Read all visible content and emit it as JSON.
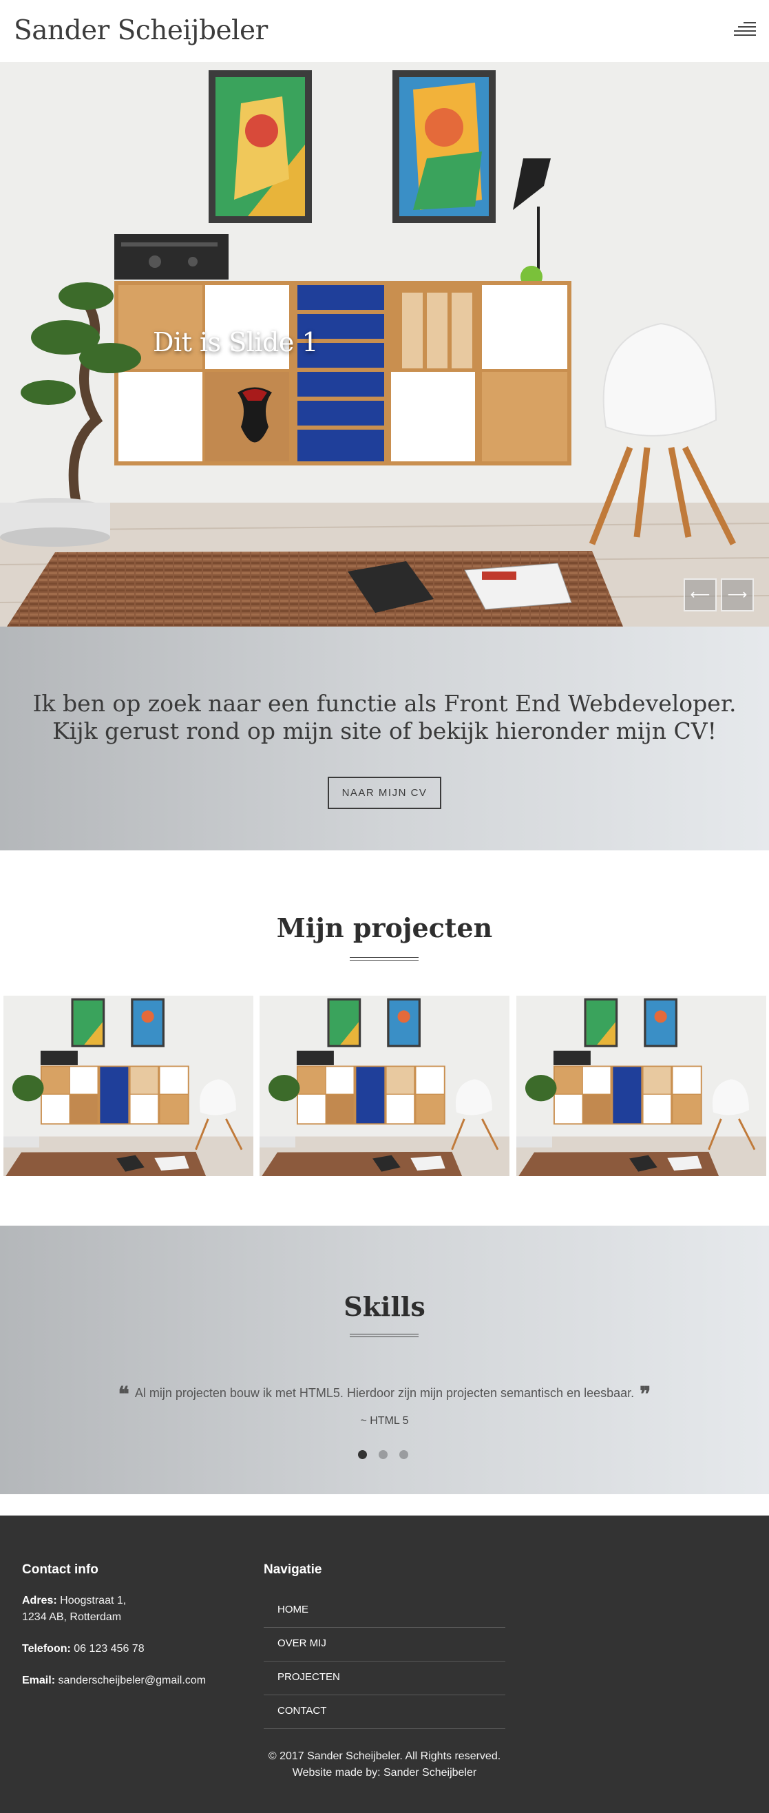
{
  "header": {
    "site_title": "Sander Scheijbeler"
  },
  "hero": {
    "slide_caption": "Dit is Slide 1",
    "prev_label": "⟵",
    "next_label": "⟶"
  },
  "intro": {
    "line1": "Ik ben op zoek naar een functie als Front End Webdeveloper.",
    "line2": "Kijk gerust rond op mijn site of bekijk hieronder mijn CV!",
    "button_label": "NAAR MIJN CV"
  },
  "projects": {
    "title": "Mijn projecten"
  },
  "skills": {
    "title": "Skills",
    "quote": "Al mijn projecten bouw ik met HTML5. Hierdoor zijn mijn projecten semantisch en leesbaar.",
    "author": "~ HTML 5",
    "active_slide": 1
  },
  "footer": {
    "contact_heading": "Contact info",
    "adres_label": "Adres:",
    "adres_line1": "Hoogstraat 1,",
    "adres_line2": "1234 AB, Rotterdam",
    "telefoon_label": "Telefoon:",
    "telefoon_value": "06 123 456 78",
    "email_label": "Email:",
    "email_value": "sanderscheijbeler@gmail.com",
    "nav_heading": "Navigatie",
    "nav_items": [
      "HOME",
      "OVER MIJ",
      "PROJECTEN",
      "CONTACT"
    ],
    "copyright": "© 2017 Sander Scheijbeler. All Rights reserved.",
    "made_by": "Website made by: Sander Scheijbeler"
  },
  "colors": {
    "footer_bg": "#333333",
    "banner_gradient_start": "#b4b7ba",
    "banner_gradient_end": "#e6e9ec",
    "cabinet_blue": "#1f3f9a",
    "cabinet_wood": "#d8a263"
  }
}
